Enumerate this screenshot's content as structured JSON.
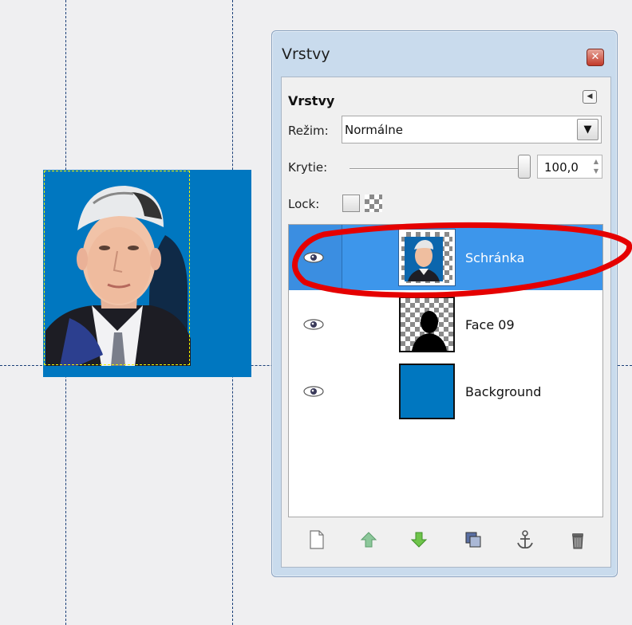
{
  "colors": {
    "canvas_fill": "#0077c0",
    "selected_row": "#3d96eb",
    "annotation_stroke": "#e50000",
    "guide": "#1a3f78",
    "selection_marching_ants": "#f4f400"
  },
  "dock": {
    "title": "Vrstvy",
    "close_icon": "close-icon"
  },
  "panel": {
    "title": "Vrstvy",
    "menu_icon": "triangle-left-icon",
    "mode_label": "Režim:",
    "mode_value": "Normálne",
    "opacity_label": "Krytie:",
    "opacity_value": "100,0",
    "lock_label": "Lock:",
    "lock_pixels_checked": false
  },
  "layers": [
    {
      "name": "Schránka",
      "visible": true,
      "selected": true,
      "thumb": "portrait-on-checkerboard"
    },
    {
      "name": "Face 09",
      "visible": true,
      "selected": false,
      "thumb": "silhouette-on-checkerboard"
    },
    {
      "name": "Background",
      "visible": true,
      "selected": false,
      "thumb": "solid-blue"
    }
  ],
  "toolbar": {
    "buttons": [
      {
        "name": "new-layer-button",
        "icon": "new-document-icon"
      },
      {
        "name": "raise-layer-button",
        "icon": "arrow-up-icon"
      },
      {
        "name": "lower-layer-button",
        "icon": "arrow-down-icon"
      },
      {
        "name": "duplicate-layer-button",
        "icon": "duplicate-icon"
      },
      {
        "name": "anchor-layer-button",
        "icon": "anchor-icon"
      },
      {
        "name": "delete-layer-button",
        "icon": "trash-icon"
      }
    ]
  }
}
